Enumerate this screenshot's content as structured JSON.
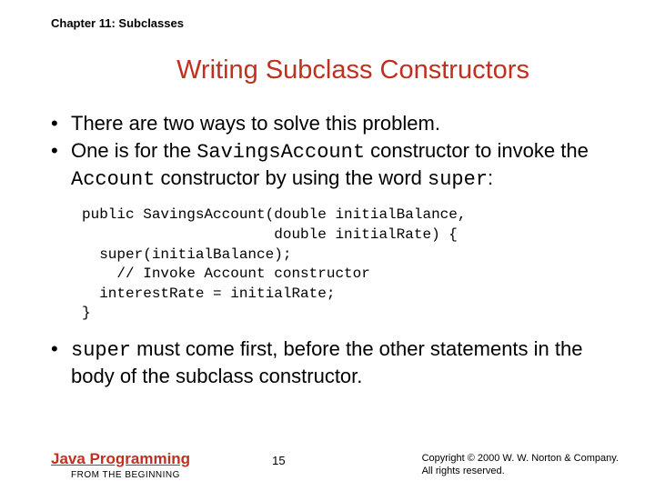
{
  "header": {
    "chapter": "Chapter 11: Subclasses"
  },
  "title": "Writing Subclass Constructors",
  "bullets": {
    "b1": "There are two ways to solve this problem.",
    "b2a": "One is for the ",
    "b2code1": "SavingsAccount",
    "b2b": " constructor to invoke the ",
    "b2code2": "Account",
    "b2c": " constructor by using the word ",
    "b2code3": "super",
    "b2d": ":",
    "b3code": "super",
    "b3a": " must come first, before the other statements in the body of the subclass constructor."
  },
  "code": "public SavingsAccount(double initialBalance,\n                      double initialRate) {\n  super(initialBalance);\n    // Invoke Account constructor\n  interestRate = initialRate;\n}",
  "footer": {
    "book_title": "Java Programming",
    "book_subtitle": "FROM THE BEGINNING",
    "page": "15",
    "copyright_line1": "Copyright © 2000 W. W. Norton & Company.",
    "copyright_line2": "All rights reserved."
  }
}
